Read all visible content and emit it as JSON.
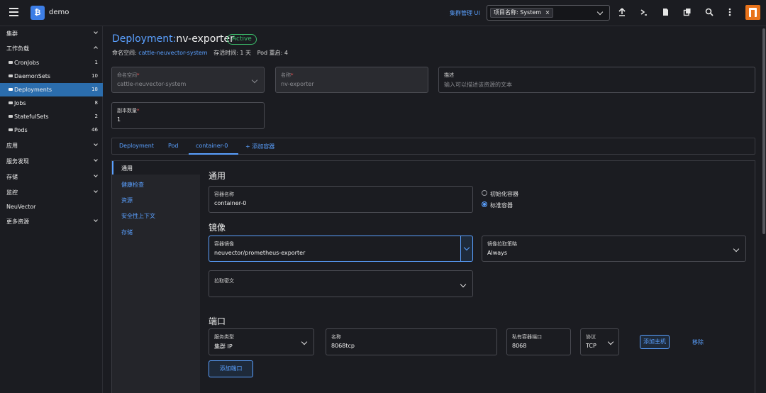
{
  "topbar": {
    "app_name": "demo",
    "cluster_link": "集群管理 UI",
    "project_chip": "项目名称: System",
    "chip_close": "×"
  },
  "sidebar": {
    "items": [
      {
        "label": "集群",
        "type": "group",
        "state": "collapsed"
      },
      {
        "label": "工作负载",
        "type": "group",
        "state": "expanded"
      },
      {
        "label": "CronJobs",
        "type": "sub",
        "count": "1"
      },
      {
        "label": "DaemonSets",
        "type": "sub",
        "count": "10"
      },
      {
        "label": "Deployments",
        "type": "sub",
        "count": "18",
        "active": true
      },
      {
        "label": "Jobs",
        "type": "sub",
        "count": "8"
      },
      {
        "label": "StatefulSets",
        "type": "sub",
        "count": "2"
      },
      {
        "label": "Pods",
        "type": "sub",
        "count": "46"
      },
      {
        "label": "应用",
        "type": "group",
        "state": "collapsed"
      },
      {
        "label": "服务发现",
        "type": "group",
        "state": "collapsed"
      },
      {
        "label": "存储",
        "type": "group",
        "state": "collapsed"
      },
      {
        "label": "监控",
        "type": "group",
        "state": "collapsed"
      },
      {
        "label": "NeuVector",
        "type": "link"
      },
      {
        "label": "更多资源",
        "type": "group",
        "state": "collapsed"
      }
    ]
  },
  "header": {
    "kind": "Deployment:",
    "name": "nv-exporter",
    "status": "Active",
    "namespace_label": "命名空间:",
    "namespace_value": "cattle-neuvector-system",
    "age": "存活时间: 1 天",
    "restarts": "Pod 重启: 4"
  },
  "form": {
    "namespace": {
      "label": "命名空间",
      "value": "cattle-neuvector-system"
    },
    "name": {
      "label": "名称",
      "value": "nv-exporter"
    },
    "description": {
      "label": "描述",
      "placeholder": "输入可以描述该资源的文本"
    },
    "replicas": {
      "label": "副本数量",
      "value": "1"
    }
  },
  "tabs": [
    "Deployment",
    "Pod",
    "container-0",
    "+ 添加容器"
  ],
  "container_nav": [
    "通用",
    "健康检查",
    "资源",
    "安全性上下文",
    "存储"
  ],
  "general": {
    "title": "通用",
    "container_name_label": "容器名称",
    "container_name_value": "container-0",
    "radio_init": "初始化容器",
    "radio_standard": "标准容器"
  },
  "image": {
    "title": "镜像",
    "image_label": "容器镜像",
    "image_value": "neuvector/prometheus-exporter",
    "pull_policy_label": "镜像拉取策略",
    "pull_policy_value": "Always",
    "pull_secret_label": "拉取密文"
  },
  "ports": {
    "title": "端口",
    "service_type_label": "服务类型",
    "service_type_value": "集群 IP",
    "name_label": "名称",
    "name_value": "8068tcp",
    "private_port_label": "私有容器端口",
    "private_port_value": "8068",
    "protocol_label": "协议",
    "protocol_value": "TCP",
    "add_host_button": "添加主机",
    "remove_link": "移除",
    "add_port_button": "添加端口"
  },
  "colors": {
    "accent": "#5aa0ff",
    "active_badge": "#3bbd6b",
    "required": "#ff5b5b"
  }
}
